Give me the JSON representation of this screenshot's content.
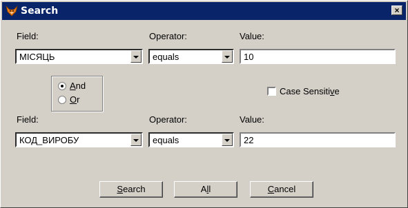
{
  "window": {
    "title": "Search",
    "icon": "fox-icon",
    "close_label": "×"
  },
  "row1": {
    "field_label": "Field:",
    "operator_label": "Operator:",
    "value_label": "Value:",
    "field_value": "МІСЯЦЬ",
    "operator_value": "equals",
    "value": "10"
  },
  "logic": {
    "and_label_pre": "",
    "and_label_accel": "A",
    "and_label_post": "nd",
    "or_label_pre": "",
    "or_label_accel": "O",
    "or_label_post": "r",
    "selected": "And"
  },
  "case_sensitive": {
    "label_pre": "Case Sensiti",
    "label_accel": "v",
    "label_post": "e",
    "checked": false
  },
  "row2": {
    "field_label": "Field:",
    "operator_label": "Operator:",
    "value_label": "Value:",
    "field_value": "КОД_ВИРОБУ",
    "operator_value": "equals",
    "value": "22"
  },
  "buttons": {
    "search_accel": "S",
    "search_rest": "earch",
    "all_pre": "A",
    "all_accel": "l",
    "all_post": "l",
    "cancel_accel": "C",
    "cancel_rest": "ancel"
  }
}
